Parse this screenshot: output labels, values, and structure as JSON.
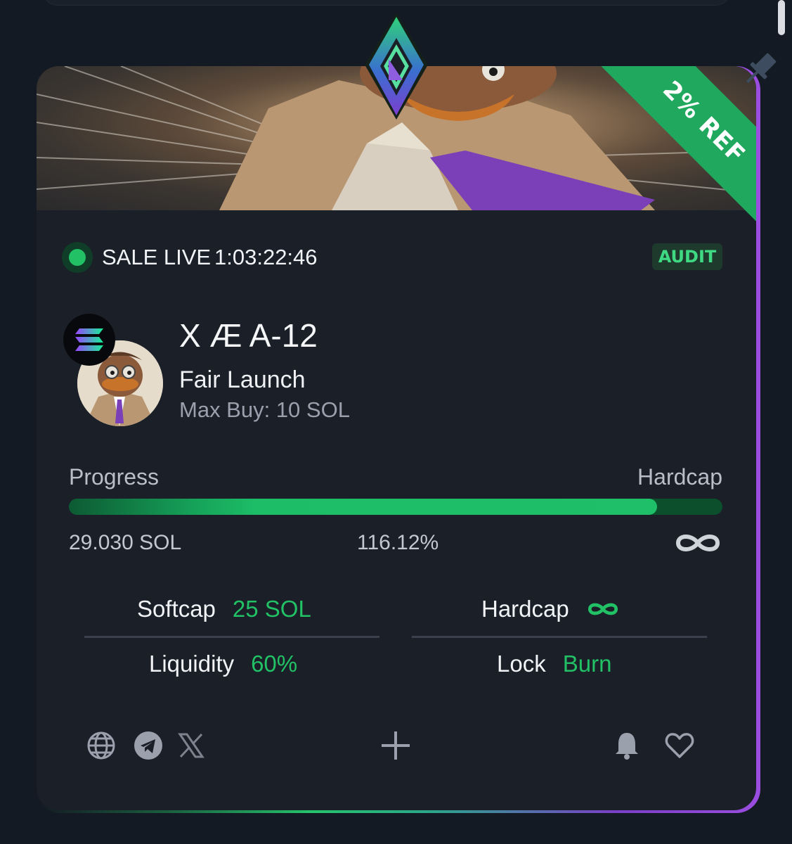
{
  "banner": {
    "ribbon_text": "2% REF",
    "ribbon_color": "#1fa85e"
  },
  "status": {
    "label": "SALE LIVE",
    "countdown": "1:03:22:46",
    "badge": "AUDIT",
    "dot_color": "#22c165"
  },
  "token": {
    "name": "X Æ A-12",
    "launch_type": "Fair Launch",
    "max_buy": "Max Buy: 10 SOL",
    "chain_icon": "solana-icon"
  },
  "progress": {
    "label_left": "Progress",
    "label_right": "Hardcap",
    "raised": "29.030 SOL",
    "percent_text": "116.12%",
    "bar_fill_fraction": 0.9,
    "hardcap_icon": "infinity-icon"
  },
  "stats": {
    "softcap": {
      "label": "Softcap",
      "value": "25 SOL"
    },
    "hardcap": {
      "label": "Hardcap",
      "value_icon": "infinity-icon"
    },
    "liquidity": {
      "label": "Liquidity",
      "value": "60%"
    },
    "lock": {
      "label": "Lock",
      "value": "Burn"
    }
  },
  "footer": {
    "left_icons": [
      "globe-icon",
      "telegram-icon",
      "x-icon"
    ],
    "center_icon": "plus-icon",
    "right_icons": [
      "bell-icon",
      "heart-icon"
    ]
  },
  "colors": {
    "accent_green": "#22c165",
    "card_bg": "#1a1f28",
    "page_bg": "#141a23"
  }
}
